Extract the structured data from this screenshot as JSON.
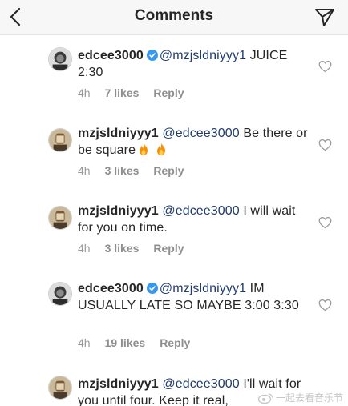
{
  "header": {
    "title": "Comments",
    "back_icon": "chevron-left-icon",
    "share_icon": "direct-send-icon"
  },
  "comments": [
    {
      "username": "edcee3000",
      "verified": true,
      "mention": "@mzjsldniyyy1",
      "text": " JUICE 2:30",
      "time": "4h",
      "likes": "7 likes",
      "reply": "Reply"
    },
    {
      "username": "mzjsldniyyy1",
      "verified": false,
      "mention": "@edcee3000",
      "text": " Be there or be square",
      "emojis": [
        "fire",
        "fire"
      ],
      "time": "4h",
      "likes": "3 likes",
      "reply": "Reply"
    },
    {
      "username": "mzjsldniyyy1",
      "verified": false,
      "mention": "@edcee3000",
      "text": " I will wait for you on time.",
      "time": "4h",
      "likes": "3 likes",
      "reply": "Reply"
    },
    {
      "username": "edcee3000",
      "verified": true,
      "mention": "@mzjsldniyyy1",
      "text": " IM USUALLY LATE SO MAYBE 3:00 3:30",
      "time": "4h",
      "likes": "19 likes",
      "reply": "Reply"
    },
    {
      "username": "mzjsldniyyy1",
      "verified": false,
      "mention": "@edcee3000",
      "text": " I'll wait for you until four. Keep it real,",
      "time": "",
      "likes": "",
      "reply": ""
    }
  ],
  "watermark": {
    "text": "一起去看音乐节",
    "icon": "weibo-logo-icon"
  },
  "colors": {
    "mention": "#1f3b6e",
    "verified": "#3897f0",
    "meta": "#8e8e8e",
    "fire": "#f4900c"
  }
}
